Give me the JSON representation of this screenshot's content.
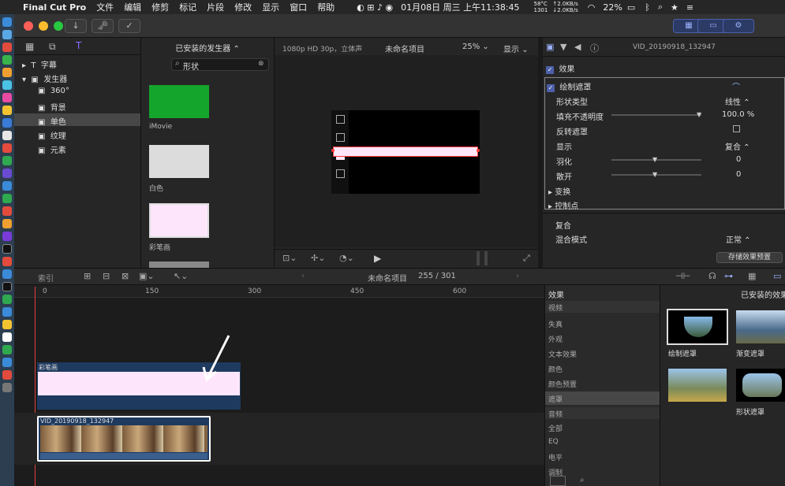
{
  "menubar": {
    "app_name": "Final Cut Pro",
    "menus": [
      "文件",
      "编辑",
      "修剪",
      "标记",
      "片段",
      "修改",
      "显示",
      "窗口",
      "帮助"
    ],
    "datetime": "01月08日 周三 上午11:38:45",
    "temp": "58°C",
    "fan": "1301",
    "net_up": "↑2.0KB/s",
    "net_down": "↓2.0KB/s",
    "battery": "22%"
  },
  "toolbar": {
    "buttons": [
      "↓",
      "🗝",
      "✓"
    ],
    "right_buttons": [
      "▦",
      "▭",
      "⚙"
    ]
  },
  "library": {
    "items": [
      {
        "label": "字幕",
        "expanded": false
      },
      {
        "label": "发生器",
        "expanded": true
      },
      {
        "label": "360°"
      },
      {
        "label": "背景"
      },
      {
        "label": "单色",
        "selected": true
      },
      {
        "label": "纹理"
      },
      {
        "label": "元素"
      }
    ]
  },
  "browser": {
    "header": "已安装的发生器 ⌃",
    "search_value": "形状",
    "thumbs": [
      {
        "label": "iMovie",
        "color": "#14a52c"
      },
      {
        "label": "白色",
        "color": "#dcdcdc"
      },
      {
        "label": "彩笔画",
        "color": "#fde6fb"
      }
    ]
  },
  "viewer": {
    "format": "1080p HD 30p，立体声",
    "project": "未命名项目",
    "zoom": "25%",
    "display": "显示"
  },
  "inspector": {
    "clip_name": "VID_20190918_132947",
    "effects_label": "效果",
    "mask_label": "绘制遮罩",
    "params": [
      {
        "label": "形状类型",
        "value": "线性 ⌃"
      },
      {
        "label": "填充不透明度",
        "value": "100.0 %"
      },
      {
        "label": "反转遮罩",
        "value": ""
      },
      {
        "label": "显示",
        "value": "复合 ⌃"
      },
      {
        "label": "羽化",
        "value": "0"
      },
      {
        "label": "散开",
        "value": "0"
      },
      {
        "label": "变换",
        "value": ""
      },
      {
        "label": "控制点",
        "value": ""
      }
    ],
    "composite_label": "复合",
    "blend_label": "混合模式",
    "blend_value": "正常 ⌃",
    "save_button": "存储效果预置"
  },
  "timeline": {
    "index_label": "索引",
    "project": "未命名项目",
    "position": "255 / 301",
    "ruler": [
      "0",
      "150",
      "300",
      "450",
      "600"
    ],
    "clip_title": "彩笔画",
    "clip_video": "VID_20190918_132947"
  },
  "effects_browser": {
    "header": "效果",
    "installed": "已安装的效果",
    "categories": [
      "视频",
      "失真",
      "外观",
      "文本效果",
      "颜色",
      "颜色预置",
      "遮罩",
      "音频",
      "全部",
      "EQ",
      "电平",
      "调制"
    ],
    "selected_category": "遮罩",
    "effects": [
      "绘制遮罩",
      "渐变遮罩",
      "",
      "形状遮罩"
    ]
  },
  "colors": {
    "accent": "#4c5fa8",
    "selection": "#4a4a4a",
    "pink": "#fde6fb",
    "timeline_blue": "#1e3a5f"
  }
}
